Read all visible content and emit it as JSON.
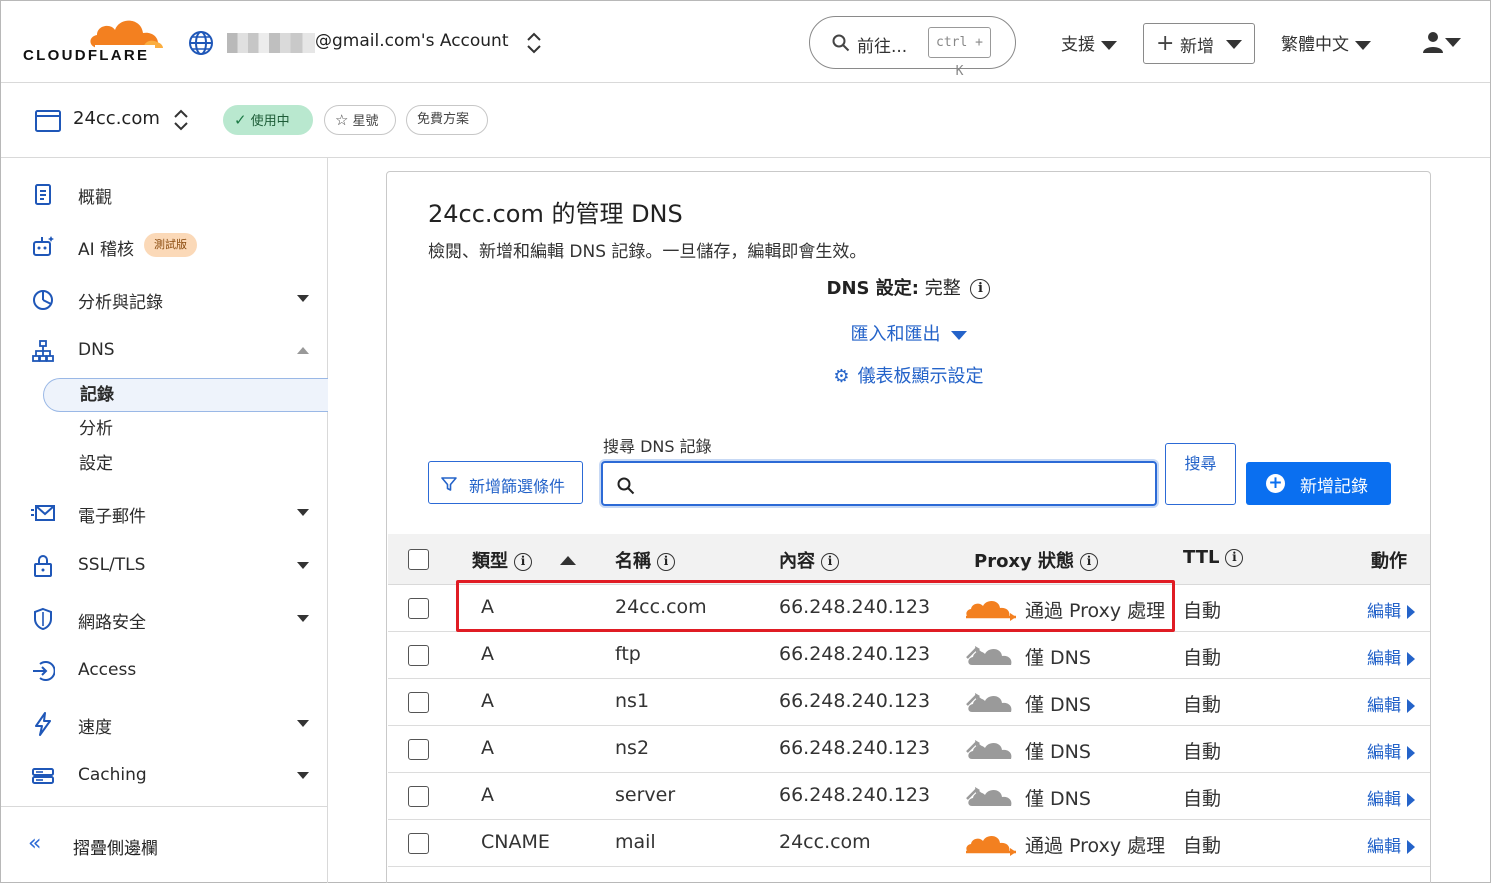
{
  "topbar": {
    "logo_text": "CLOUDFLARE",
    "account": "@gmail.com's Account",
    "goto_label": "前往...",
    "goto_shortcut": "ctrl + K",
    "support": "支援",
    "add": "新增",
    "language": "繁體中文"
  },
  "zone": {
    "name": "24cc.com",
    "status": "使用中",
    "star": "星號",
    "plan": "免費方案"
  },
  "sidebar": {
    "items": [
      {
        "label": "概觀"
      },
      {
        "label": "AI 稽核",
        "badge": "測試版"
      },
      {
        "label": "分析與記錄"
      },
      {
        "label": "DNS"
      },
      {
        "label": "電子郵件"
      },
      {
        "label": "SSL/TLS"
      },
      {
        "label": "網路安全"
      },
      {
        "label": "Access"
      },
      {
        "label": "速度"
      },
      {
        "label": "Caching"
      }
    ],
    "dns_sub": [
      "記錄",
      "分析",
      "設定"
    ],
    "collapse": "摺疊側邊欄"
  },
  "main": {
    "title": "24cc.com 的管理 DNS",
    "description": "檢閱、新增和編輯 DNS 記錄。一旦儲存，編輯即會生效。",
    "dns_setting_label": "DNS 設定:",
    "dns_setting_value": "完整",
    "import_export": "匯入和匯出",
    "dashboard_settings": "儀表板顯示設定",
    "filter_button": "新增篩選條件",
    "search_label": "搜尋 DNS 記錄",
    "search_placeholder": "",
    "search_button": "搜尋",
    "add_record": "新增記錄"
  },
  "table": {
    "headers": {
      "type": "類型",
      "name": "名稱",
      "content": "內容",
      "proxy": "Proxy 狀態",
      "ttl": "TTL",
      "actions": "動作"
    },
    "edit_label": "編輯",
    "rows": [
      {
        "type": "A",
        "name": "24cc.com",
        "content": "66.248.240.123",
        "proxy": "通過 Proxy 處理",
        "ttl": "自動",
        "proxied": true
      },
      {
        "type": "A",
        "name": "ftp",
        "content": "66.248.240.123",
        "proxy": "僅 DNS",
        "ttl": "自動",
        "proxied": false
      },
      {
        "type": "A",
        "name": "ns1",
        "content": "66.248.240.123",
        "proxy": "僅 DNS",
        "ttl": "自動",
        "proxied": false
      },
      {
        "type": "A",
        "name": "ns2",
        "content": "66.248.240.123",
        "proxy": "僅 DNS",
        "ttl": "自動",
        "proxied": false
      },
      {
        "type": "A",
        "name": "server",
        "content": "66.248.240.123",
        "proxy": "僅 DNS",
        "ttl": "自動",
        "proxied": false
      },
      {
        "type": "CNAME",
        "name": "mail",
        "content": "24cc.com",
        "proxy": "通過 Proxy 處理",
        "ttl": "自動",
        "proxied": true
      }
    ]
  },
  "colors": {
    "accent": "#2463c9",
    "primary_button": "#0a6ff0",
    "proxy_orange": "#f38020",
    "highlight_red": "#e01c24"
  }
}
